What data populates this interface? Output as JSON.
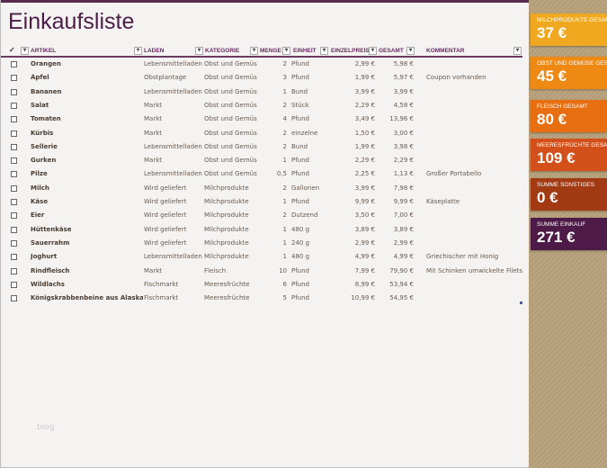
{
  "title": "Einkaufsliste",
  "headers": {
    "check": "✓",
    "artikel": "ARTIKEL",
    "laden": "LADEN",
    "kategorie": "KATEGORIE",
    "menge": "MENGE",
    "einheit": "EINHEIT",
    "einzelpreis": "EINZELPREIS",
    "gesamt": "GESAMT",
    "kommentar": "KOMMENTAR"
  },
  "rows": [
    [
      "Orangen",
      "Lebensmittelladen",
      "Obst und Gemüs",
      "2",
      "Pfund",
      "2,99 €",
      "5,98 €",
      ""
    ],
    [
      "Äpfel",
      "Obstplantage",
      "Obst und Gemüs",
      "3",
      "Pfund",
      "1,99 €",
      "5,97 €",
      "Coupon vorhanden"
    ],
    [
      "Bananen",
      "Lebensmittelladen",
      "Obst und Gemüs",
      "1",
      "Bund",
      "3,99 €",
      "3,99 €",
      ""
    ],
    [
      "Salat",
      "Markt",
      "Obst und Gemüs",
      "2",
      "Stück",
      "2,29 €",
      "4,58 €",
      ""
    ],
    [
      "Tomaten",
      "Markt",
      "Obst und Gemüs",
      "4",
      "Pfund",
      "3,49 €",
      "13,96 €",
      ""
    ],
    [
      "Kürbis",
      "Markt",
      "Obst und Gemüs",
      "2",
      "einzelne",
      "1,50 €",
      "3,00 €",
      ""
    ],
    [
      "Sellerie",
      "Lebensmittelladen",
      "Obst und Gemüs",
      "2",
      "Bund",
      "1,99 €",
      "3,98 €",
      ""
    ],
    [
      "Gurken",
      "Markt",
      "Obst und Gemüs",
      "1",
      "Pfund",
      "2,29 €",
      "2,29 €",
      ""
    ],
    [
      "Pilze",
      "Lebensmittelladen",
      "Obst und Gemüs",
      "0,5",
      "Pfund",
      "2,25 €",
      "1,13 €",
      "Großer Portabello"
    ],
    [
      "Milch",
      "Wird geliefert",
      "Milchprodukte",
      "2",
      "Gallonen",
      "3,99 €",
      "7,98 €",
      ""
    ],
    [
      "Käse",
      "Wird geliefert",
      "Milchprodukte",
      "1",
      "Pfund",
      "9,99 €",
      "9,99 €",
      "Käseplatte"
    ],
    [
      "Eier",
      "Wird geliefert",
      "Milchprodukte",
      "2",
      "Dutzend",
      "3,50 €",
      "7,00 €",
      ""
    ],
    [
      "Hüttenkäse",
      "Wird geliefert",
      "Milchprodukte",
      "1",
      "480 g",
      "3,89 €",
      "3,89 €",
      ""
    ],
    [
      "Sauerrahm",
      "Wird geliefert",
      "Milchprodukte",
      "1",
      "240 g",
      "2,99 €",
      "2,99 €",
      ""
    ],
    [
      "Joghurt",
      "Lebensmittelladen",
      "Milchprodukte",
      "1",
      "480 g",
      "4,99 €",
      "4,99 €",
      "Griechischer mit Honig"
    ],
    [
      "Rindfleisch",
      "Markt",
      "Fleisch",
      "10",
      "Pfund",
      "7,99 €",
      "79,90 €",
      "Mit Schinken umwickelte Filets"
    ],
    [
      "Wildlachs",
      "Fischmarkt",
      "Meeresfrüchte",
      "6",
      "Pfund",
      "8,99 €",
      "53,94 €",
      ""
    ],
    [
      "Königskrabbenbeine aus Alaska",
      "Fischmarkt",
      "Meeresfrüchte",
      "5",
      "Pfund",
      "10,99 €",
      "54,95 €",
      ""
    ]
  ],
  "summary": [
    {
      "label": "MILCHPRODUKTE GESAMT",
      "value": "37 €",
      "color": "#f0a820"
    },
    {
      "label": "OBST UND GEMÜSE GESAMT",
      "value": "45 €",
      "color": "#ee8a14"
    },
    {
      "label": "FLEISCH GESAMT",
      "value": "80 €",
      "color": "#e86e12"
    },
    {
      "label": "MEERESFRÜCHTE GESAMT",
      "value": "109 €",
      "color": "#d4501a"
    },
    {
      "label": "SUMME SONSTIGES",
      "value": "0 €",
      "color": "#a23a14"
    },
    {
      "label": "SUMME EINKAUF",
      "value": "271 €",
      "color": "#4e1a48"
    }
  ],
  "watermark": "blog"
}
